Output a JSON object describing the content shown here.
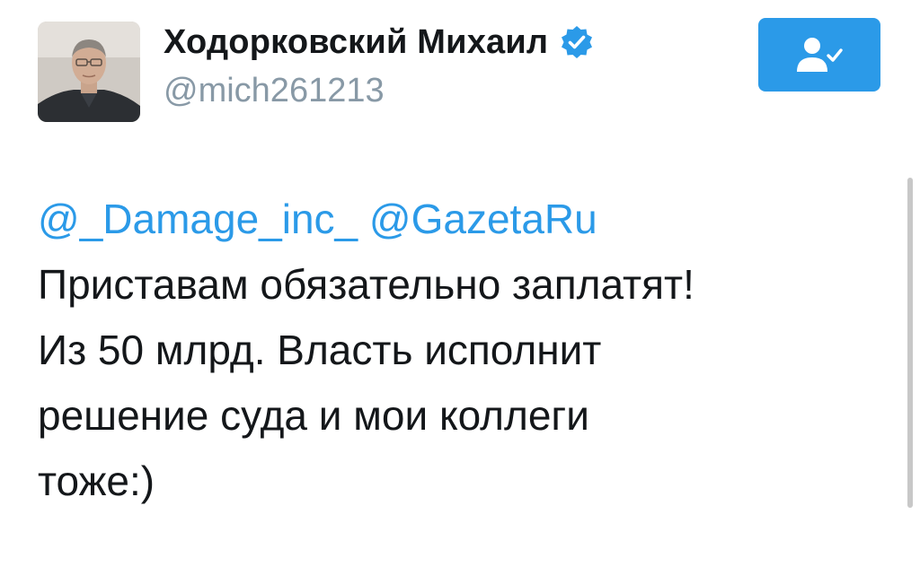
{
  "author": {
    "display_name": "Ходорковский Михаил",
    "handle": "@mich261213",
    "verified": true,
    "avatar_icon": "profile-photo"
  },
  "follow_button": {
    "icon": "following-check-icon",
    "color": "#2b9ae8"
  },
  "tweet": {
    "mentions": [
      "@_Damage_inc_",
      "@GazetaRu"
    ],
    "lines": [
      "Приставам обязательно заплатят!",
      "Из 50 млрд. Власть исполнит",
      "решение суда и мои коллеги",
      "тоже:)"
    ]
  },
  "colors": {
    "link": "#2b9ae8",
    "text": "#14171a",
    "secondary": "#8899a6"
  }
}
